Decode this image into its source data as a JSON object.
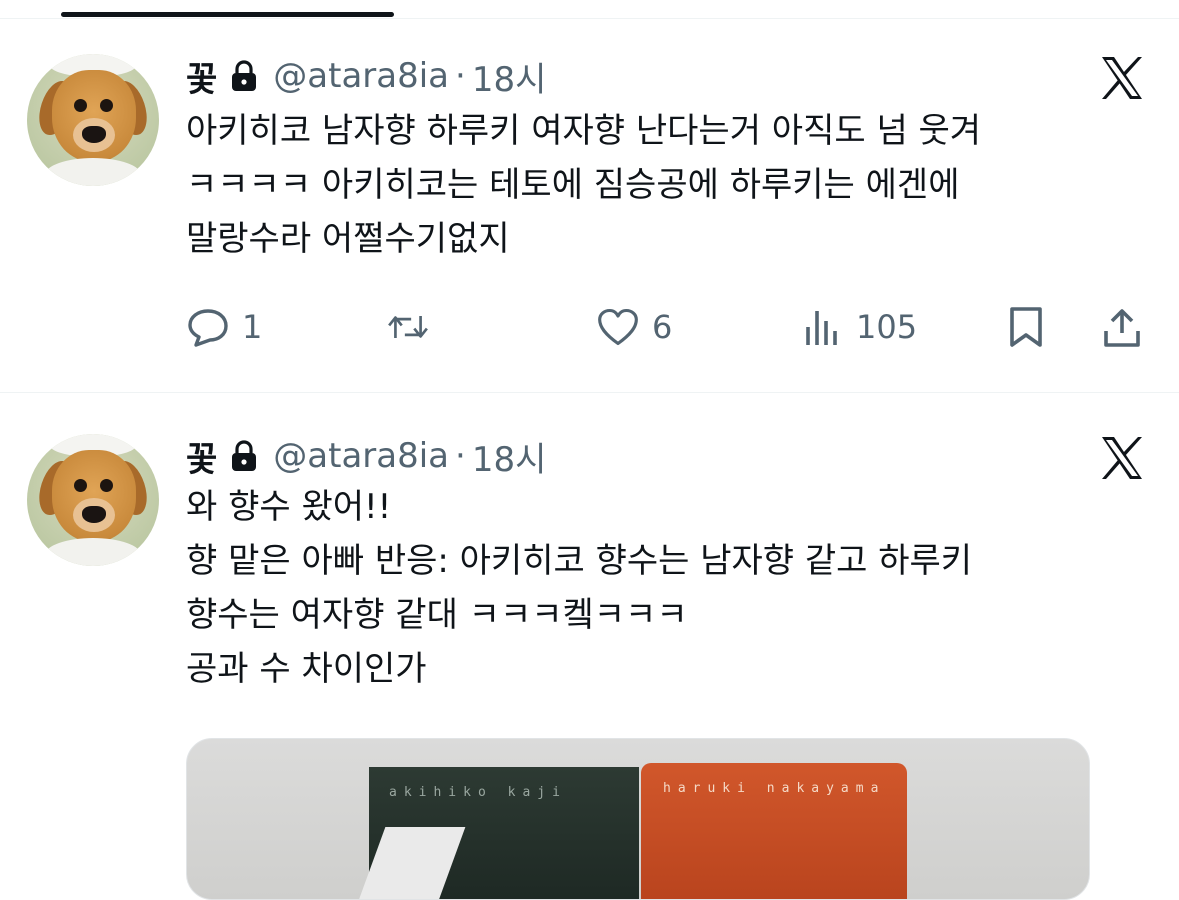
{
  "tweets": [
    {
      "name": "꽃",
      "handle": "@atara8ia",
      "separator": "·",
      "time": "18시",
      "lines": [
        "아키히코 남자향 하루키 여자향 난다는거 아직도 넘 웃겨",
        "ㅋㅋㅋㅋ 아키히코는 테토에 짐승공에 하루키는 에겐에",
        "말랑수라 어쩔수기없지"
      ],
      "actions": {
        "reply_count": "1",
        "like_count": "6",
        "view_count": "105"
      }
    },
    {
      "name": "꽃",
      "handle": "@atara8ia",
      "separator": "·",
      "time": "18시",
      "lines": [
        "와 향수 왔어!!",
        "향 맡은 아빠 반응: 아키히코 향수는 남자향 같고 하루키",
        "향수는 여자향 같대 ㅋㅋㅋ켘ㅋㅋㅋ",
        "공과 수 차이인가"
      ],
      "media": {
        "box_left_label": "akihiko kaji",
        "box_right_label": "haruki nakayama"
      }
    }
  ],
  "icons": {
    "lock": "lock-icon",
    "platform": "x-logo-icon",
    "reply": "reply-icon",
    "retweet": "retweet-icon",
    "like": "heart-icon",
    "views": "views-icon",
    "bookmark": "bookmark-icon",
    "share": "share-icon"
  },
  "colors": {
    "text": "#0f1419",
    "secondary": "#536471",
    "divider": "#eff3f4"
  }
}
